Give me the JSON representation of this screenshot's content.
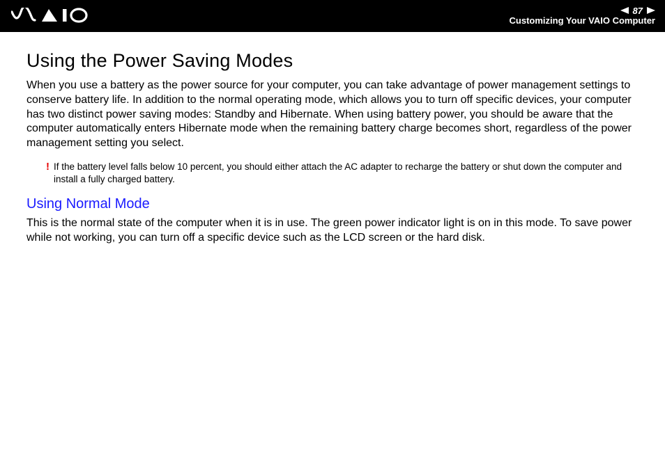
{
  "header": {
    "page_number": "87",
    "section": "Customizing Your VAIO Computer"
  },
  "main": {
    "title": "Using the Power Saving Modes",
    "intro": "When you use a battery as the power source for your computer, you can take advantage of power management settings to conserve battery life. In addition to the normal operating mode, which allows you to turn off specific devices, your computer has two distinct power saving modes: Standby and Hibernate. When using battery power, you should be aware that the computer automatically enters Hibernate mode when the remaining battery charge becomes short, regardless of the power management setting you select.",
    "warning_mark": "!",
    "warning": "If the battery level falls below 10 percent, you should either attach the AC adapter to recharge the battery or shut down the computer and install a fully charged battery.",
    "subheading": "Using Normal Mode",
    "subbody": "This is the normal state of the computer when it is in use. The green power indicator light is on in this mode. To save power while not working, you can turn off a specific device such as the LCD screen or the hard disk."
  }
}
